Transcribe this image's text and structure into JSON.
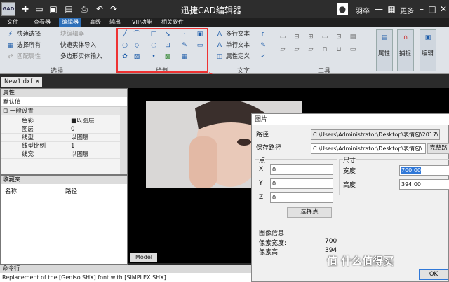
{
  "app": {
    "title": "迅捷CAD编辑器",
    "logo": "GAD",
    "user": "羽卒",
    "more": "更多"
  },
  "menu": [
    "文件",
    "查看器",
    "编辑器",
    "高级",
    "输出",
    "VIP功能",
    "相关软件"
  ],
  "ribbon": {
    "select": [
      "快速选择",
      "选择所有",
      "匹配属性"
    ],
    "blocks": [
      "块编辑器",
      "快速实体导入",
      "多边形实体输入"
    ],
    "groups": {
      "select": "选择",
      "draw": "绘制",
      "text": "文字",
      "tools": "工具"
    },
    "text_btns": [
      "多行文本",
      "单行文本",
      "属性定义"
    ],
    "big_btns": [
      "属性",
      "捕捉",
      "编辑"
    ]
  },
  "doc_tab": "New1.dxf",
  "properties": {
    "title": "属性",
    "default": "默认值",
    "section": "一般设置",
    "rows": [
      [
        "色彩",
        "■以图层"
      ],
      [
        "图层",
        "0"
      ],
      [
        "线型",
        "以图层"
      ],
      [
        "线型比例",
        "1"
      ],
      [
        "线宽",
        "以图层"
      ]
    ]
  },
  "favorites": {
    "title": "收藏夹",
    "cols": [
      "名称",
      "路径"
    ]
  },
  "model_tab": "Model",
  "command": {
    "title": "命令行",
    "text": "Replacement of the [Geniso.SHX] font with [SIMPLEX.SHX]"
  },
  "dialog": {
    "title": "图片",
    "path_label": "路径",
    "path_value": "C:\\Users\\Administrator\\Desktop\\表情包\\2017\\",
    "save_label": "保存路径",
    "save_value": "C:\\Users\\Administrator\\Desktop\\表情包\\",
    "fullpath_btn": "完整路",
    "point": {
      "title": "点",
      "x": "X",
      "y": "Y",
      "z": "Z",
      "xv": "0",
      "yv": "0",
      "zv": "0",
      "pick": "选择点"
    },
    "size": {
      "title": "尺寸",
      "w_label": "宽度",
      "w": "700.00",
      "h_label": "高度",
      "h": "394.00"
    },
    "info": {
      "title": "图像信息",
      "w_label": "像素宽度:",
      "w": "700",
      "h_label": "像素高:",
      "h": "394"
    },
    "ok": "OK"
  },
  "watermark": "值 什么值得买",
  "colors": {
    "accent": "#2e6fb8",
    "highlight": "#e33333"
  }
}
